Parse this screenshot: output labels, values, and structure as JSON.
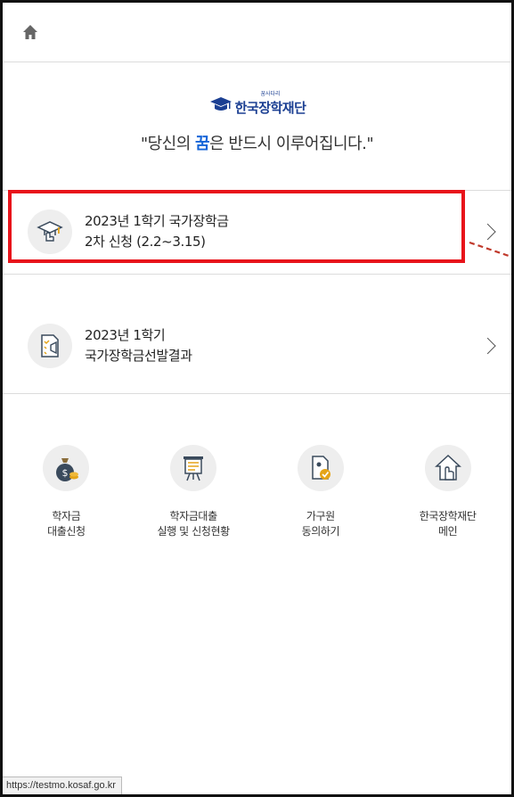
{
  "header": {
    "home_icon": "home-icon"
  },
  "brand": {
    "logo_small": "꿈사다리",
    "logo_text": "한국장학재단",
    "slogan_before": "\"당신의 ",
    "slogan_highlight": "꿈",
    "slogan_after": "은 반드시 이루어집니다.\""
  },
  "menu": [
    {
      "line1": "2023년 1학기 국가장학금",
      "line2": "2차 신청 (2.2~3.15)",
      "icon": "graduation-cap-hand-icon"
    },
    {
      "line1": "2023년 1학기",
      "line2": "국가장학금선발결과",
      "icon": "document-megaphone-icon"
    }
  ],
  "quick_links": [
    {
      "line1": "학자금",
      "line2": "대출신청",
      "icon": "money-bag-icon"
    },
    {
      "line1": "학자금대출",
      "line2": "실행 및 신청현황",
      "icon": "presentation-board-icon"
    },
    {
      "line1": "가구원",
      "line2": "동의하기",
      "icon": "document-check-icon"
    },
    {
      "line1": "한국장학재단",
      "line2": "메인",
      "icon": "house-hand-icon"
    }
  ],
  "status_bar": {
    "url": "https://testmo.kosaf.go.kr"
  },
  "colors": {
    "highlight_box": "#e8141b",
    "brand_blue": "#1b3f92",
    "slogan_highlight": "#1565d8"
  }
}
